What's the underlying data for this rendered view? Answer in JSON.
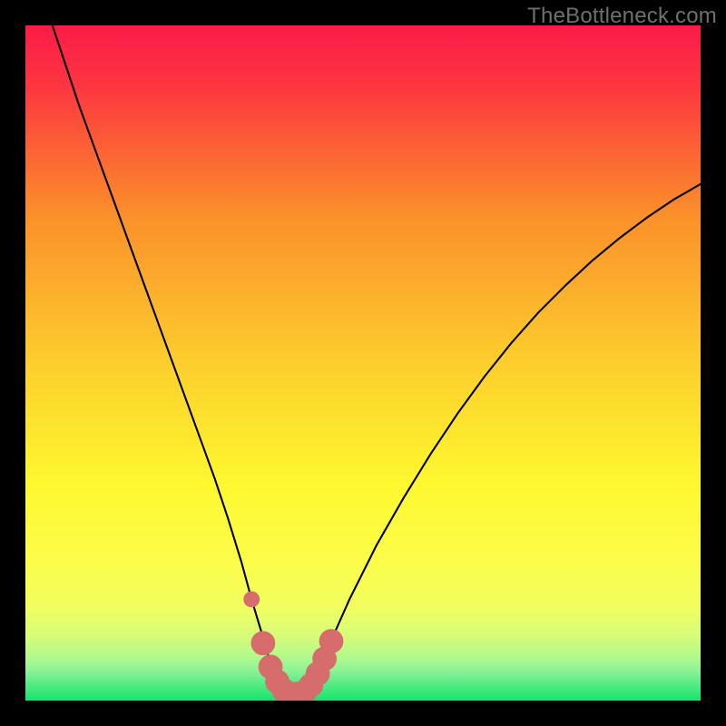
{
  "watermark": "TheBottleneck.com",
  "chart_data": {
    "type": "line",
    "title": "",
    "xlabel": "",
    "ylabel": "",
    "xlim": [
      0,
      100
    ],
    "ylim": [
      0,
      100
    ],
    "grid": false,
    "colors": {
      "gradient_top": "#fc1b48",
      "gradient_mid1": "#fb8f2b",
      "gradient_mid2": "#fef830",
      "gradient_low1": "#e2fc65",
      "gradient_low2": "#95f595",
      "gradient_bottom": "#17e46d",
      "curve": "#000000",
      "marker": "#d76c6c"
    },
    "series": [
      {
        "name": "bottleneck-curve",
        "x": [
          4,
          6,
          8,
          10,
          12,
          14,
          16,
          18,
          20,
          22,
          24,
          26,
          28,
          30,
          32,
          33.5,
          35,
          36,
          37,
          38,
          39,
          40,
          41,
          42,
          44,
          46,
          48,
          52,
          56,
          60,
          64,
          68,
          72,
          76,
          80,
          84,
          88,
          92,
          96,
          100
        ],
        "y": [
          100,
          94,
          88,
          82.5,
          77,
          71.5,
          66,
          60.5,
          55,
          49.5,
          44,
          38.5,
          33,
          27,
          20.5,
          15,
          10,
          6.5,
          3.5,
          1.5,
          0.5,
          0.5,
          1,
          2.5,
          6,
          10.5,
          15,
          23,
          30,
          36.5,
          42.5,
          48,
          53,
          57.5,
          61.5,
          65.2,
          68.5,
          71.5,
          74.2,
          76.5
        ]
      }
    ],
    "markers": {
      "name": "highlight-band",
      "color": "#d76c6c",
      "points": [
        {
          "x": 33.5,
          "y": 15,
          "r": 1.2
        },
        {
          "x": 35.2,
          "y": 8.5,
          "r": 1.8
        },
        {
          "x": 36.3,
          "y": 5,
          "r": 1.8
        },
        {
          "x": 37.3,
          "y": 2.8,
          "r": 1.8
        },
        {
          "x": 38.3,
          "y": 1.5,
          "r": 1.8
        },
        {
          "x": 39.3,
          "y": 1,
          "r": 1.8
        },
        {
          "x": 40.3,
          "y": 1,
          "r": 1.8
        },
        {
          "x": 41.3,
          "y": 1.3,
          "r": 1.8
        },
        {
          "x": 42.3,
          "y": 2.3,
          "r": 1.8
        },
        {
          "x": 43.3,
          "y": 4,
          "r": 1.8
        },
        {
          "x": 44.3,
          "y": 6.2,
          "r": 1.8
        },
        {
          "x": 45.3,
          "y": 8.8,
          "r": 1.8
        }
      ]
    }
  }
}
